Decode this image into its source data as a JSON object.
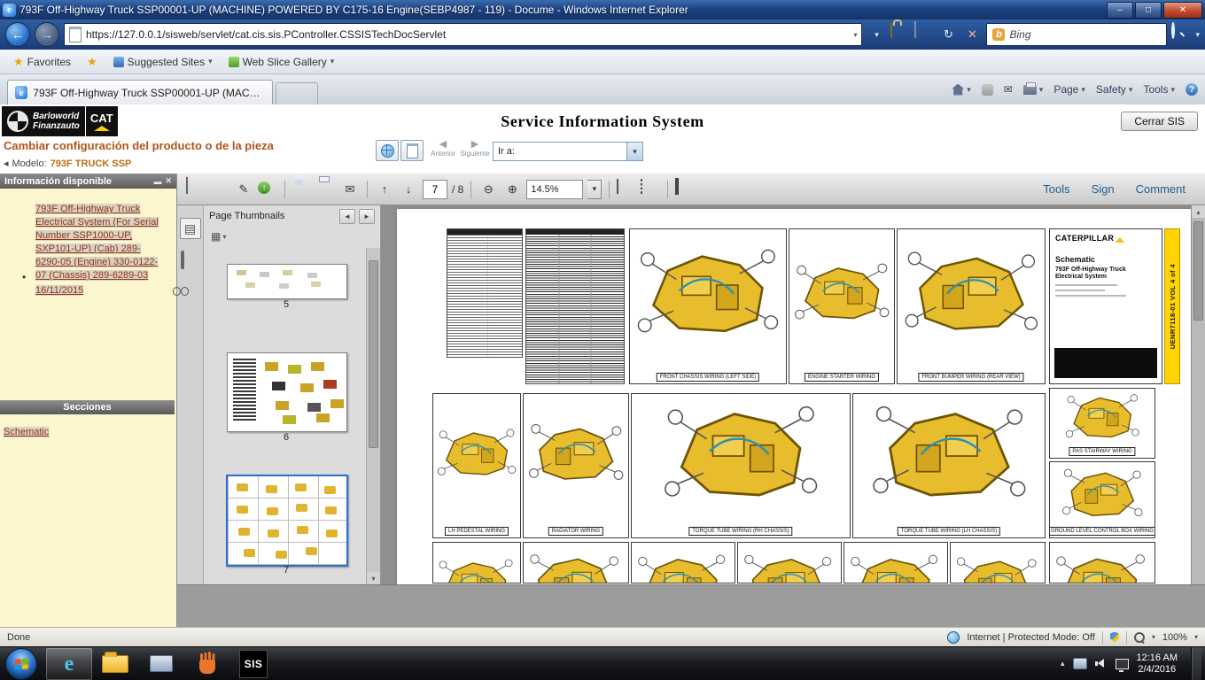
{
  "icons": {
    "minimize": "–",
    "maximize": "□",
    "close": "✕",
    "back": "←",
    "forward": "→",
    "caret": "▾",
    "refresh": "↻",
    "stop": "✕",
    "star": "★",
    "star_plus": "★",
    "help": "?",
    "ie_e": "e",
    "bing_b": "b",
    "pencil": "✎",
    "envelope": "✉",
    "up": "↑",
    "down": "↓",
    "zoom_out": "⊖",
    "zoom_in": "⊕",
    "bullet": "•",
    "tri_left": "◂",
    "play_left": "◀",
    "play_right": "▶",
    "chevron_up": "▴",
    "panel_left": "◄",
    "panel_right": "►",
    "grid": "▦",
    "pages": "▤",
    "pin": "▬",
    "down_small": "▾"
  },
  "window": {
    "title": "793F Off-Highway Truck SSP00001-UP (MACHINE) POWERED BY C175-16 Engine(SEBP4987 - 119) - Docume - Windows Internet Explorer"
  },
  "browser": {
    "url": "https://127.0.0.1/sisweb/servlet/cat.cis.sis.PController.CSSISTechDocServlet",
    "search_engine": "Bing",
    "favorites_label": "Favorites",
    "suggested_sites": "Suggested Sites",
    "web_slice": "Web Slice Gallery",
    "tab_title": "793F Off-Highway Truck SSP00001-UP (MACHIN...",
    "menu_page": "Page",
    "menu_safety": "Safety",
    "menu_tools": "Tools"
  },
  "sis": {
    "logo_line1": "Barloworld",
    "logo_line2": "Finanzauto",
    "cat_logo": "CAT",
    "title": "Service Information System",
    "close_button": "Cerrar SIS",
    "breadcrumb": "Cambiar configuración del producto o de la pieza",
    "model_label": "Modelo:",
    "model_value": "793F TRUCK SSP",
    "prev": "Anterior",
    "next": "Siguiente",
    "goto_label": "Ir a:"
  },
  "sidebar": {
    "header": "Información disponible",
    "doc_link": "793F Off-Highway Truck Electrical System (For Serial Number SSP1000-UP, SXP101-UP) (Cab) 289-6290-05 (Engine) 330-0122-07 (Chassis) 289-6289-03",
    "doc_date": "16/11/2015",
    "sections_header": "Secciones",
    "section_link": "Schematic"
  },
  "pdf": {
    "toolbar": {
      "page_current": "7",
      "page_total": "/ 8",
      "zoom": "14.5%",
      "tools": "Tools",
      "sign": "Sign",
      "comment": "Comment"
    },
    "thumbnails": {
      "title": "Page Thumbnails",
      "pages": [
        "5",
        "6",
        "7"
      ]
    },
    "page": {
      "cells_row1": [
        "FRONT CHASSIS WIRING (LEFT SIDE)",
        "ENGINE STARTER WIRING",
        "FRONT BUMPER WIRING (REAR VIEW)"
      ],
      "cells_row2": [
        "LH PEDESTAL WIRING",
        "RADIATOR WIRING",
        "TORQUE TUBE WIRING (RH CHASSIS)",
        "TORQUE TUBE WIRING (LH CHASSIS)"
      ],
      "cells_right": [
        "PAS STAIRWAY WIRING",
        "GROUND LEVEL CONTROL BOX WIRING"
      ],
      "title_block": {
        "brand": "CATERPILLAR",
        "doc_type": "Schematic",
        "doc_title": "793F Off-Highway Truck Electrical System",
        "edge_label": "UENR7118-01 VOL 4 of 4"
      }
    }
  },
  "status_bar": {
    "status": "Done",
    "zone": "Internet | Protected Mode: Off",
    "zoom": "100%"
  },
  "taskbar": {
    "sis_app": "SIS",
    "time": "12:16 AM",
    "date": "2/4/2016"
  }
}
